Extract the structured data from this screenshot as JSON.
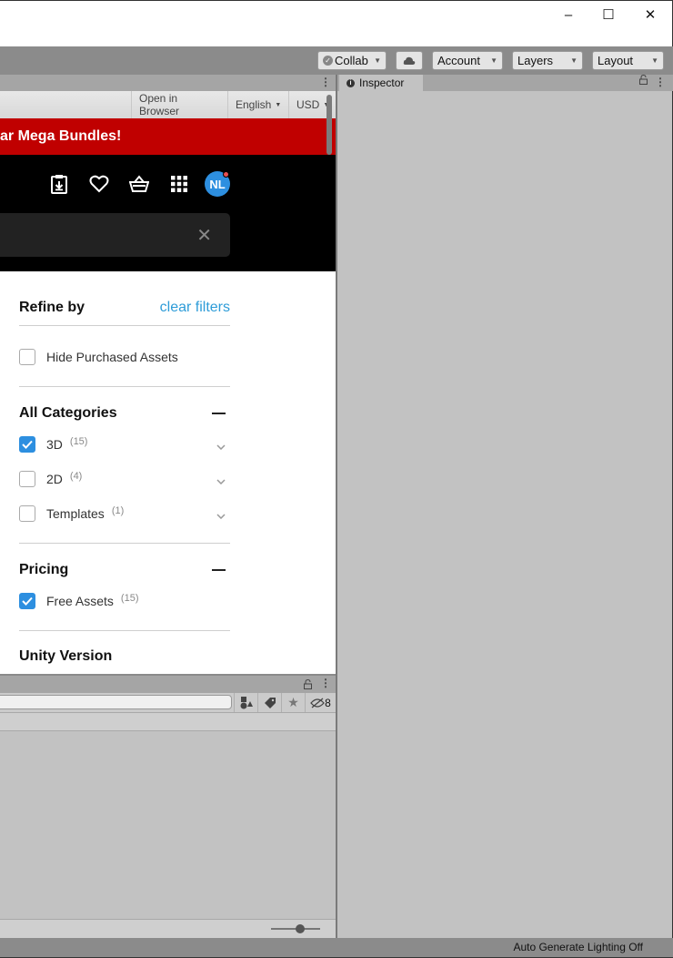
{
  "window": {
    "controls": {
      "minimize": "–",
      "maximize": "☐",
      "close": "✕"
    }
  },
  "toolbar": {
    "collab_label": "Collab",
    "account_label": "Account",
    "layers_label": "Layers",
    "layout_label": "Layout"
  },
  "inspector": {
    "tab_label": "Inspector"
  },
  "asset_store": {
    "topbar": {
      "open_in_browser": "Open in Browser",
      "language": "English",
      "currency": "USD"
    },
    "promo_text": "ar Mega Bundles!",
    "nav": {
      "avatar_initials": "NL",
      "icons": [
        "downloads-icon",
        "heart-icon",
        "basket-icon",
        "apps-grid-icon"
      ]
    },
    "search": {
      "value": ""
    },
    "filters": {
      "refine_by": "Refine by",
      "clear_filters": "clear filters",
      "hide_purchased": {
        "label": "Hide Purchased Assets",
        "checked": false
      },
      "categories": {
        "title": "All Categories",
        "items": [
          {
            "label": "3D",
            "count": "(15)",
            "checked": true
          },
          {
            "label": "2D",
            "count": "(4)",
            "checked": false
          },
          {
            "label": "Templates",
            "count": "(1)",
            "checked": false
          }
        ]
      },
      "pricing": {
        "title": "Pricing",
        "items": [
          {
            "label": "Free Assets",
            "count": "(15)",
            "checked": true
          }
        ]
      },
      "unity_version_title": "Unity Version"
    }
  },
  "project": {
    "hidden_count": "8"
  },
  "status": {
    "text": "Auto Generate Lighting Off"
  },
  "colors": {
    "promo_red": "#c00000",
    "link_blue": "#2e9cd8",
    "checkbox_blue": "#2d8fe0",
    "avatar_blue": "#2d8fe0",
    "notification_red": "#e85050"
  }
}
